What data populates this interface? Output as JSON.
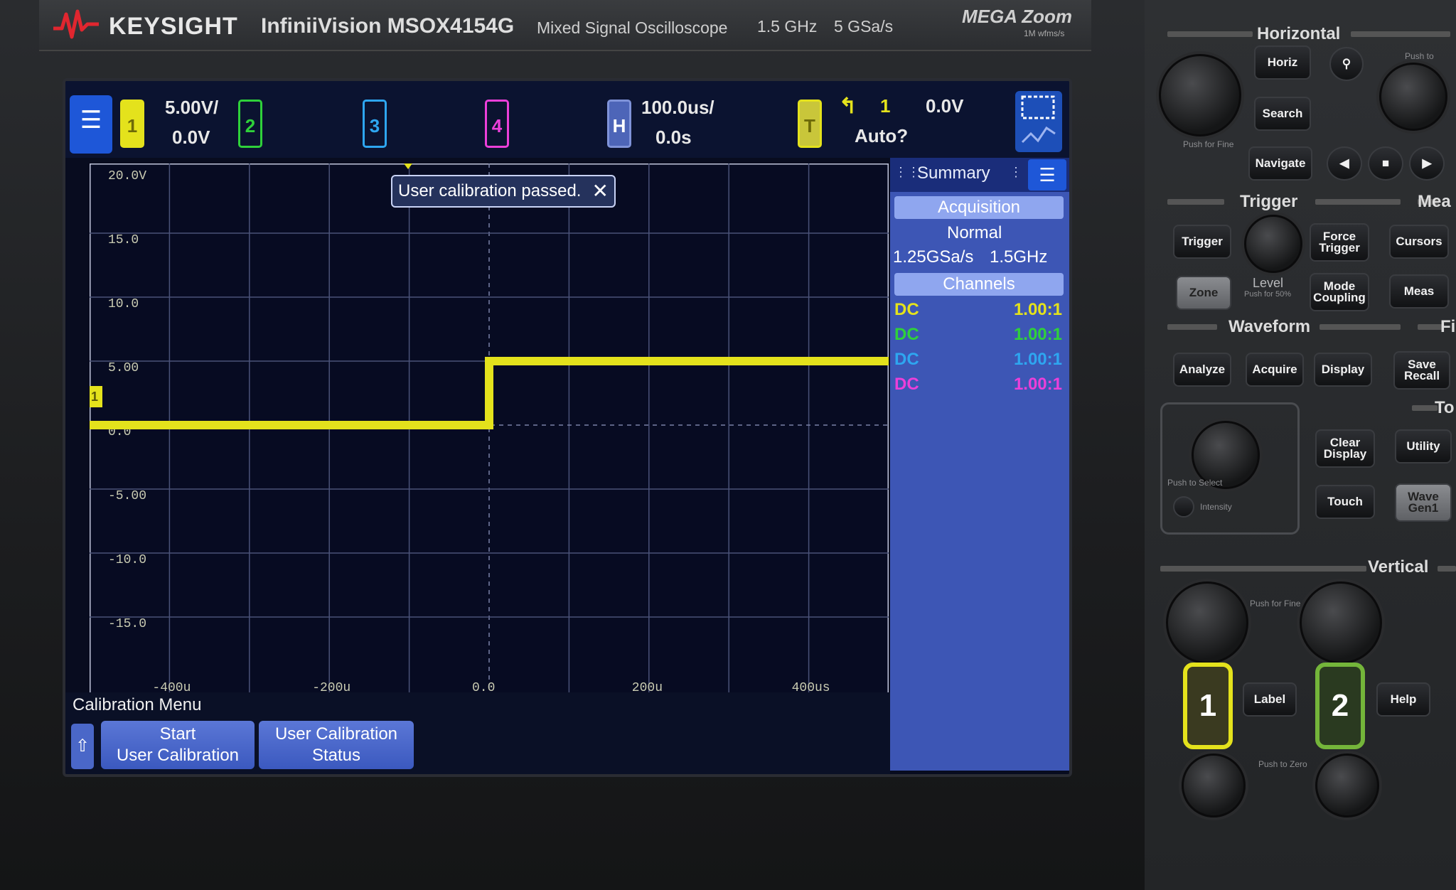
{
  "device": {
    "brand": "KEYSIGHT",
    "model": "InfiniiVision MSOX4154G",
    "description": "Mixed Signal Oscilloscope",
    "bandwidth": "1.5 GHz",
    "sample_rate": "5 GSa/s",
    "megazoom": "MEGA Zoom",
    "megazoom_sub": "1M wfms/s"
  },
  "topbar": {
    "ch1_label": "1",
    "ch1_scale": "5.00V/",
    "ch1_offset": "0.0V",
    "ch2_label": "2",
    "ch3_label": "3",
    "ch4_label": "4",
    "horiz_label": "H",
    "time_scale": "100.0us/",
    "time_delay": "0.0s",
    "trig_label": "T",
    "trig_source": "1",
    "trig_level": "0.0V",
    "trig_mode": "Auto?"
  },
  "colors": {
    "ch1": "#e4e21c",
    "ch2": "#2fd13a",
    "ch3": "#2ea6f0",
    "ch4": "#ec3fd9",
    "accent": "#1e57d8"
  },
  "graticule": {
    "y_labels": [
      "20.0V",
      "15.0",
      "10.0",
      "5.00",
      "0.0",
      "-5.00",
      "-10.0",
      "-15.0"
    ],
    "x_labels": [
      "-400u",
      "-200u",
      "0.0",
      "200u",
      "400us"
    ]
  },
  "chart_data": {
    "type": "line",
    "series": [
      {
        "name": "1",
        "x": [
          -500,
          0,
          0,
          500
        ],
        "values": [
          0,
          0,
          5,
          5
        ]
      }
    ],
    "xlim": [
      -500,
      500
    ],
    "ylim": [
      -20,
      20
    ],
    "grid": true
  },
  "popup": {
    "message": "User calibration passed."
  },
  "summary": {
    "title": "Summary",
    "acquisition_header": "Acquisition",
    "acq_mode": "Normal",
    "acq_rate": "1.25GSa/s",
    "acq_bw": "1.5GHz",
    "channels_header": "Channels",
    "channels": [
      {
        "coupling": "DC",
        "probe": "1.00:1"
      },
      {
        "coupling": "DC",
        "probe": "1.00:1"
      },
      {
        "coupling": "DC",
        "probe": "1.00:1"
      },
      {
        "coupling": "DC",
        "probe": "1.00:1"
      }
    ]
  },
  "softkeys": {
    "menu_title": "Calibration Menu",
    "start_line1": "Start",
    "start_line2": "User Calibration",
    "status_line1": "User Calibration",
    "status_line2": "Status"
  },
  "front_panel": {
    "horizontal": "Horizontal",
    "horiz_key": "Horiz",
    "search_key": "Search",
    "navigate_key": "Navigate",
    "push_to": "Push to",
    "push_for_fine": "Push for Fine",
    "trigger": "Trigger",
    "trigger_key": "Trigger",
    "force_trigger": "Force Trigger",
    "zone_key": "Zone",
    "level": "Level",
    "push_for_50": "Push for 50%",
    "mode_coupling": "Mode Coupling",
    "measure": "Mea",
    "cursors_key": "Cursors",
    "meas_key": "Meas",
    "waveform": "Waveform",
    "analyze_key": "Analyze",
    "acquire_key": "Acquire",
    "display_key": "Display",
    "file": "Fi",
    "save_recall": "Save Recall",
    "tools": "To",
    "clear_display": "Clear Display",
    "utility_key": "Utility",
    "push_to_select": "Push to Select",
    "intensity": "Intensity",
    "touch_key": "Touch",
    "wavegen_key": "Wave Gen1",
    "vertical": "Vertical",
    "ch1_key": "1",
    "ch2_key": "2",
    "label_key": "Label",
    "help_key": "Help",
    "push_to_zero": "Push to Zero"
  }
}
